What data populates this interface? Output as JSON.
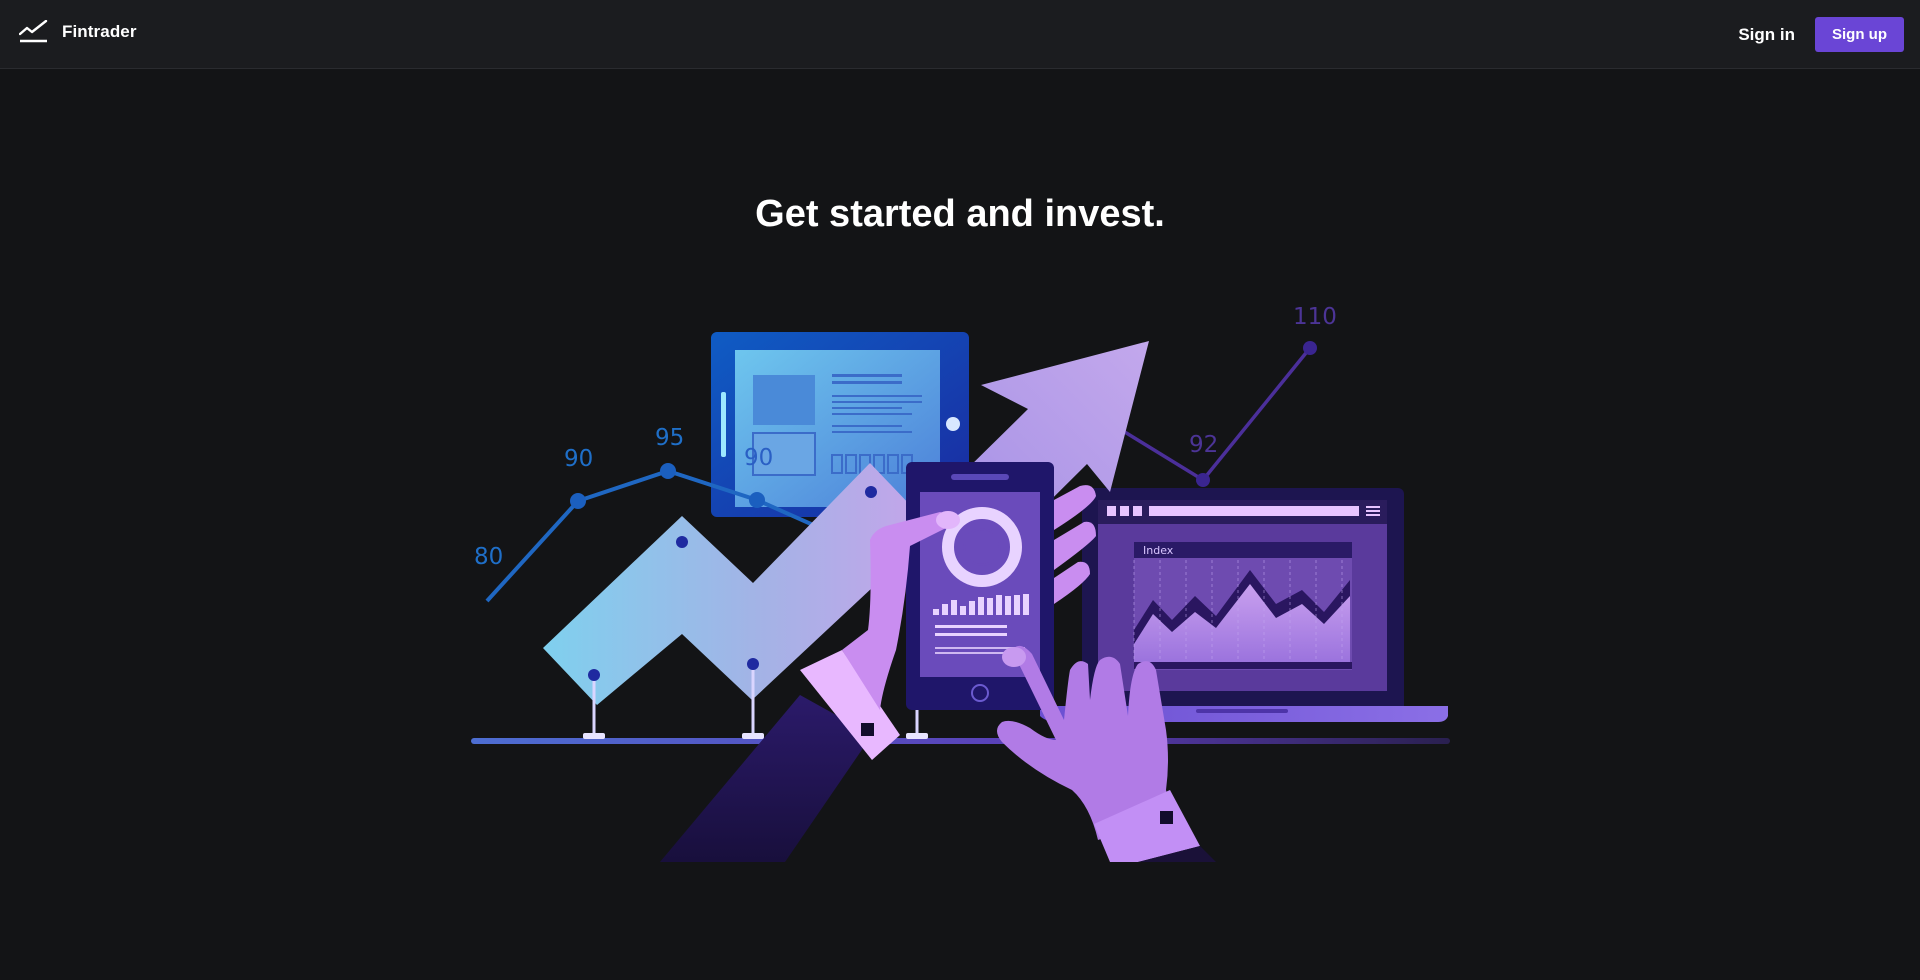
{
  "header": {
    "brand": "Fintrader",
    "brand_icon": "line-chart-icon",
    "sign_in_label": "Sign in",
    "sign_up_label": "Sign up"
  },
  "main": {
    "headline": "Get started and invest."
  },
  "illustration": {
    "left_chart_labels": [
      "80",
      "90",
      "95",
      "90"
    ],
    "right_chart_labels": [
      "92",
      "110"
    ],
    "laptop_panel_label": "Index"
  },
  "colors": {
    "background": "#131416",
    "header_background": "#1b1c1f",
    "accent": "#6a45d6",
    "text": "#ffffff"
  }
}
